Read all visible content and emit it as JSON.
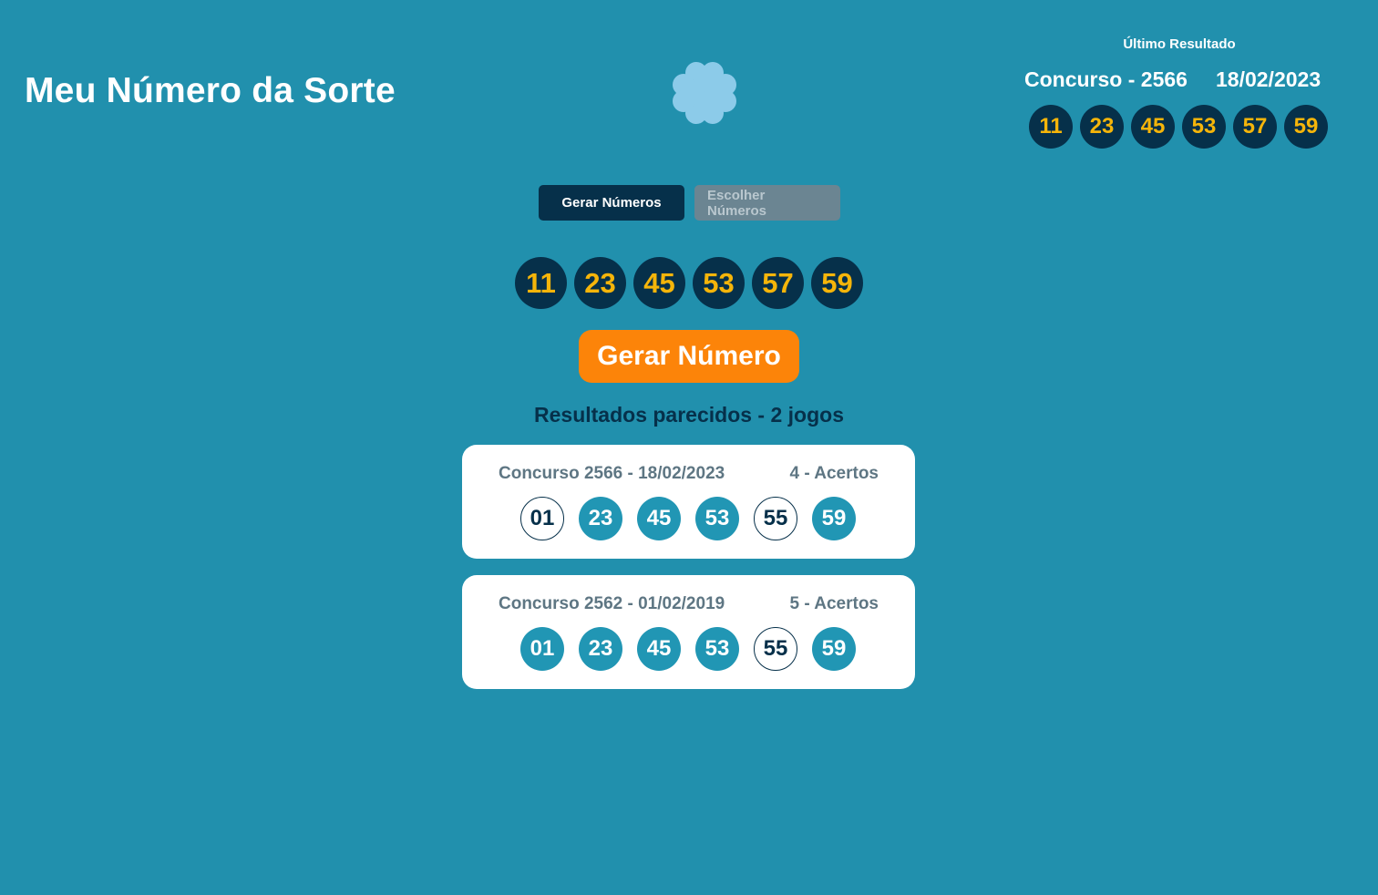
{
  "header": {
    "title": "Meu Número da Sorte"
  },
  "latest_result": {
    "label": "Último Resultado",
    "contest": "Concurso - 2566",
    "date": "18/02/2023",
    "numbers": [
      "11",
      "23",
      "45",
      "53",
      "57",
      "59"
    ]
  },
  "tabs": [
    {
      "label": "Gerar Números",
      "active": true
    },
    {
      "label": "Escolher Números",
      "active": false
    }
  ],
  "generated_numbers": [
    "11",
    "23",
    "45",
    "53",
    "57",
    "59"
  ],
  "generate_button": {
    "label": "Gerar Número"
  },
  "similar": {
    "title": "Resultados parecidos - 2 jogos",
    "results": [
      {
        "contest": "Concurso 2566  -  18/02/2023",
        "hits": "4 - Acertos",
        "numbers": [
          {
            "value": "01",
            "hit": false
          },
          {
            "value": "23",
            "hit": true
          },
          {
            "value": "45",
            "hit": true
          },
          {
            "value": "53",
            "hit": true
          },
          {
            "value": "55",
            "hit": false
          },
          {
            "value": "59",
            "hit": true
          }
        ]
      },
      {
        "contest": "Concurso 2562  -  01/02/2019",
        "hits": "5 - Acertos",
        "numbers": [
          {
            "value": "01",
            "hit": true
          },
          {
            "value": "23",
            "hit": true
          },
          {
            "value": "45",
            "hit": true
          },
          {
            "value": "53",
            "hit": true
          },
          {
            "value": "55",
            "hit": false
          },
          {
            "value": "59",
            "hit": true
          }
        ]
      }
    ]
  },
  "colors": {
    "background": "#2190ad",
    "dark": "#06304a",
    "number_gold": "#f5b50a",
    "accent_orange": "#fc8409",
    "hit_ball": "#2196b4"
  },
  "icons": {
    "logo": "four-leaf-clover-icon"
  }
}
